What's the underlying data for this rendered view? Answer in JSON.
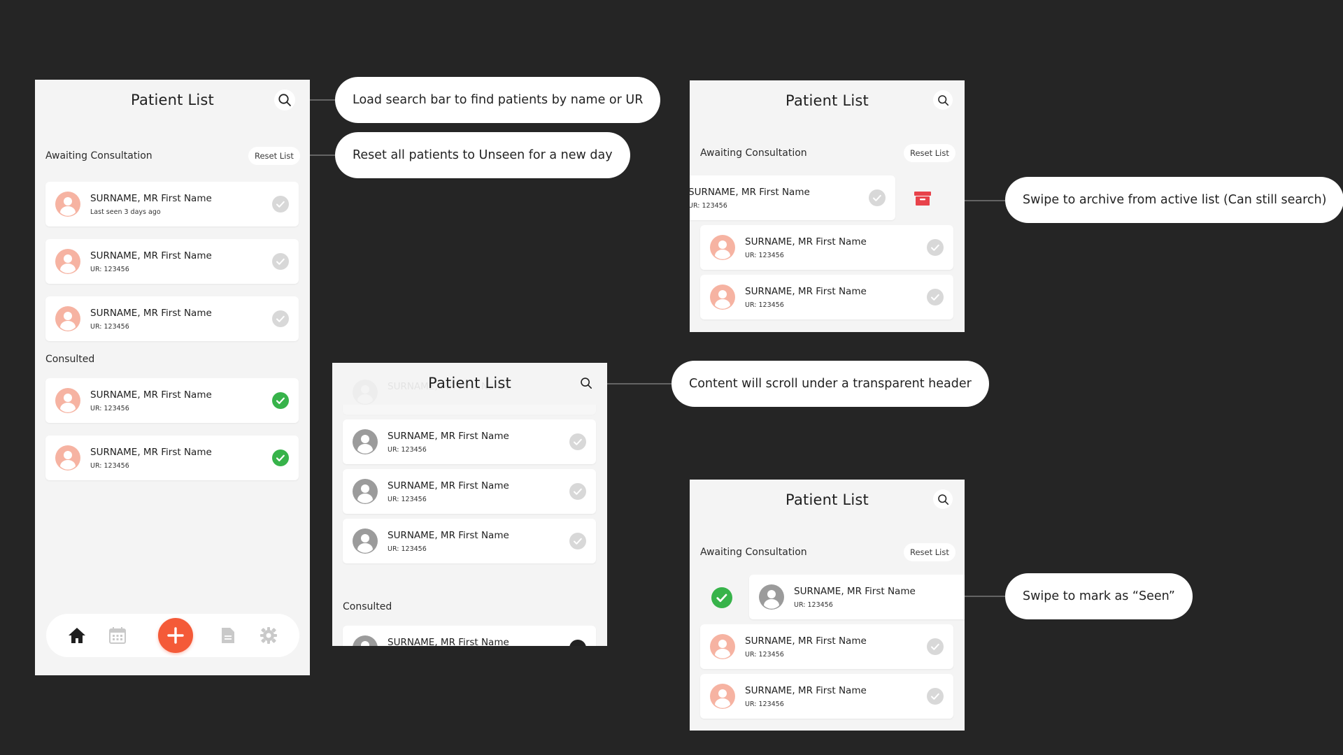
{
  "colors": {
    "background": "#252525",
    "panel": "#f4f4f4",
    "accent_orange": "#f45a38",
    "avatar_peach": "#f6b3a2",
    "check_grey": "#d5d5d5",
    "check_green": "#37b34a",
    "archive_red": "#e8424a"
  },
  "title": "Patient List",
  "awaiting_label": "Awaiting Consultation",
  "consulted_label": "Consulted",
  "reset_label": "Reset List",
  "patient_name": "SURNAME, MR First Name",
  "ur_label": "UR: 123456",
  "screen1": {
    "awaiting": [
      {
        "name": "SURNAME, MR First Name",
        "sub": "Last seen 3 days ago",
        "status": "unseen"
      },
      {
        "name": "SURNAME, MR First Name",
        "sub": "UR: 123456",
        "status": "unseen"
      },
      {
        "name": "SURNAME, MR First Name",
        "sub": "UR: 123456",
        "status": "unseen"
      }
    ],
    "consulted": [
      {
        "name": "SURNAME, MR First Name",
        "sub": "UR: 123456",
        "status": "seen"
      },
      {
        "name": "SURNAME, MR First Name",
        "sub": "UR: 123456",
        "status": "seen"
      }
    ],
    "nav": [
      "home-icon",
      "calendar-icon",
      "add-icon",
      "document-icon",
      "gear-icon"
    ]
  },
  "annotations": {
    "search": "Load search bar to find patients by name or UR",
    "reset": "Reset all patients to Unseen for a new day",
    "archive": "Swipe to archive from active list (Can still search)",
    "scroll": "Content will scroll under a transparent header",
    "seen": "Swipe to mark as “Seen”"
  }
}
